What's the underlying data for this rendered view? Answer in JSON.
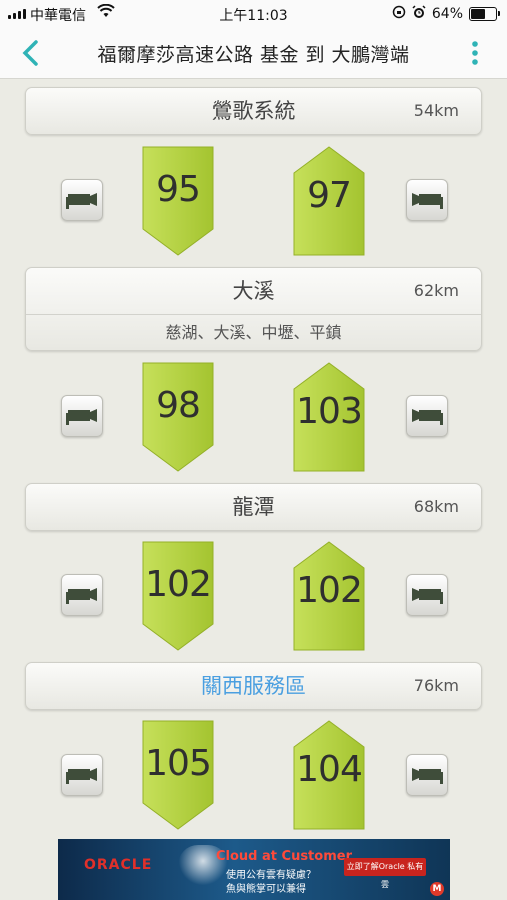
{
  "status_bar": {
    "carrier": "中華電信",
    "time": "上午11:03",
    "battery": "64%",
    "battery_level": 0.64
  },
  "nav": {
    "title": "福爾摩莎高速公路 基金 到 大鵬灣端"
  },
  "sections": [
    {
      "name": "鶯歌系統",
      "distance": "54km",
      "speed_left": "95",
      "speed_right": "97"
    },
    {
      "name": "大溪",
      "distance": "62km",
      "sub": "慈湖、大溪、中壢、平鎮",
      "speed_left": "98",
      "speed_right": "103"
    },
    {
      "name": "龍潭",
      "distance": "68km",
      "speed_left": "102",
      "speed_right": "102"
    },
    {
      "name": "關西服務區",
      "distance": "76km",
      "speed_left": "105",
      "speed_right": "104"
    }
  ],
  "ad": {
    "logo": "ORACLE",
    "headline": "Cloud at Customer",
    "line1": "使用公有雲有疑慮？",
    "line2": "魚與熊掌可以兼得",
    "cta": "立即了解Oracle 私有雲",
    "badge": "M"
  },
  "colors": {
    "badge_green": "#b4d43c",
    "service_area_blue": "#4a9fe0",
    "back_arrow": "#2fb3b6"
  }
}
